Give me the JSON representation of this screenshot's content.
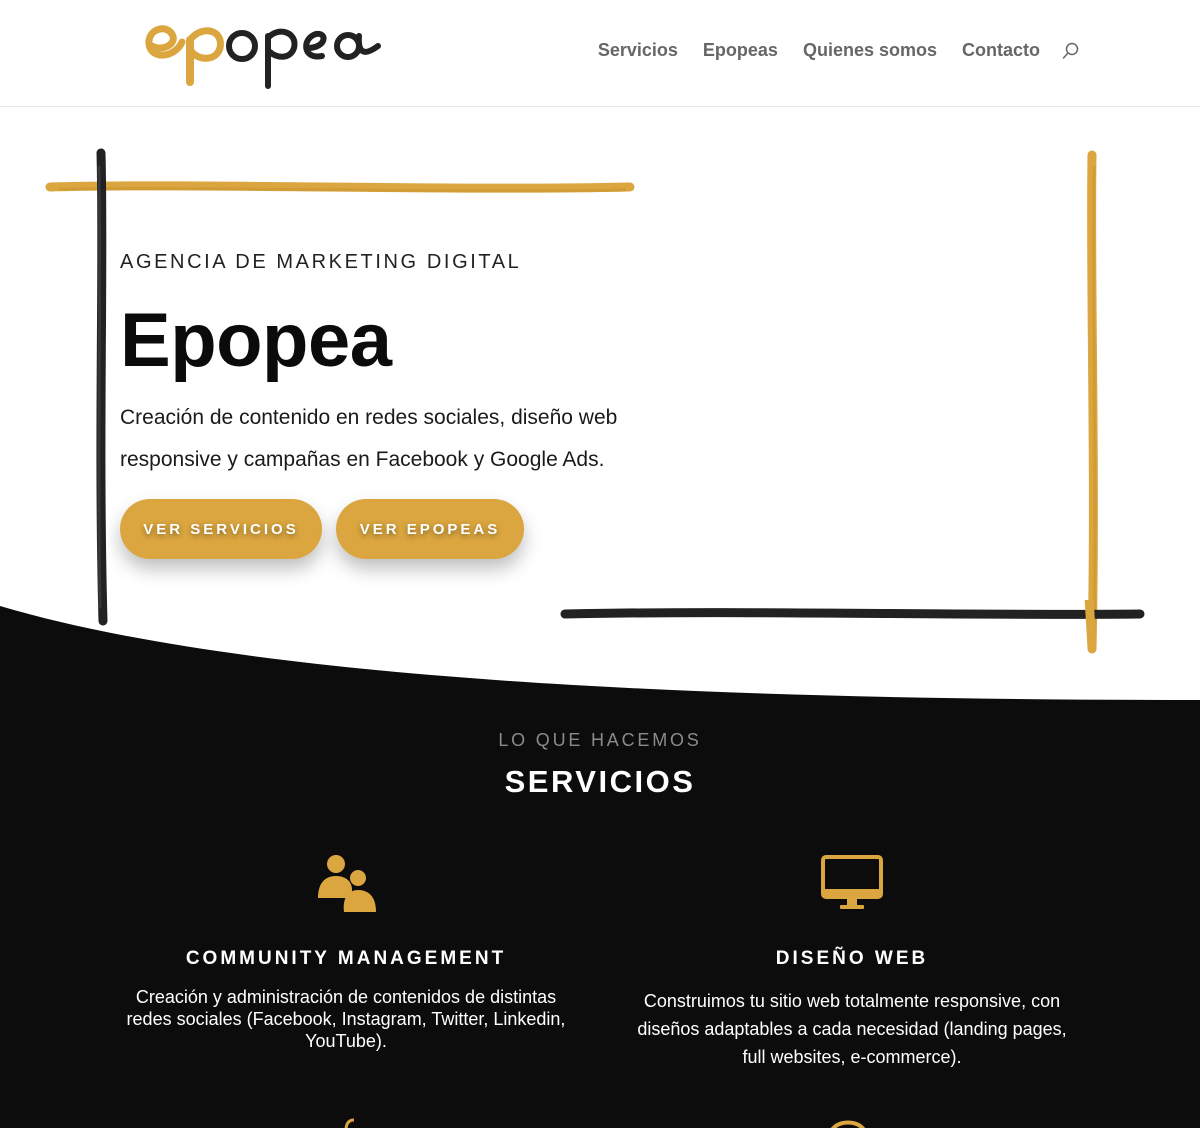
{
  "brand": {
    "logo_text": "epopea",
    "accent": "#dba63f",
    "dark": "#0d0c0c"
  },
  "nav": {
    "items": [
      "Servicios",
      "Epopeas",
      "Quienes somos",
      "Contacto"
    ],
    "search_icon": "search-icon"
  },
  "hero": {
    "eyebrow": "AGENCIA DE MARKETING DIGITAL",
    "title": "Epopea",
    "description": "Creación de contenido en redes sociales, diseño web responsive y campañas en Facebook y Google Ads.",
    "buttons": [
      "VER SERVICIOS",
      "VER EPOPEAS"
    ]
  },
  "services": {
    "eyebrow": "LO QUE HACEMOS",
    "title": "SERVICIOS",
    "cards": [
      {
        "icon": "users-icon",
        "title": "COMMUNITY MANAGEMENT",
        "description": "Creación y administración de contenidos de distintas redes sociales (Facebook, Instagram, Twitter, Linkedin, YouTube)."
      },
      {
        "icon": "monitor-icon",
        "title": "DISEÑO WEB",
        "description": "Construimos tu sitio web totalmente responsive, con diseños adaptables a cada necesidad (landing pages, full websites, e-commerce)."
      }
    ]
  }
}
